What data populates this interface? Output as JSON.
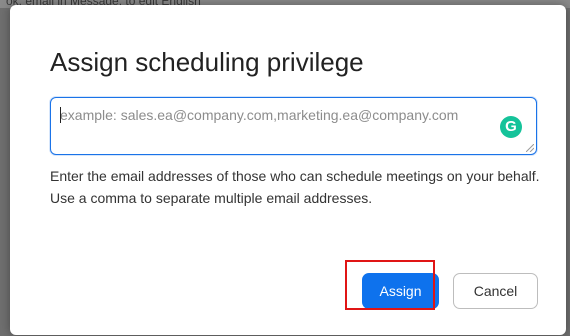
{
  "background": {
    "snippet": "ok, email in Message, to edit    English"
  },
  "dialog": {
    "title": "Assign scheduling privilege",
    "email_input": {
      "placeholder": "example: sales.ea@company.com,marketing.ea@company.com",
      "value": ""
    },
    "help_text": "Enter the email addresses of those who can schedule meetings on your behalf. Use a comma to separate multiple email addresses.",
    "buttons": {
      "assign_label": "Assign",
      "cancel_label": "Cancel"
    }
  },
  "icons": {
    "grammarly": "grammarly-icon",
    "grammarly_glyph": "G"
  },
  "colors": {
    "primary_button": "#0e72ed",
    "input_focus_border": "#1a73e8",
    "highlight_box": "#e01515",
    "grammarly": "#15c39a",
    "overlay": "#6f6f6f"
  }
}
